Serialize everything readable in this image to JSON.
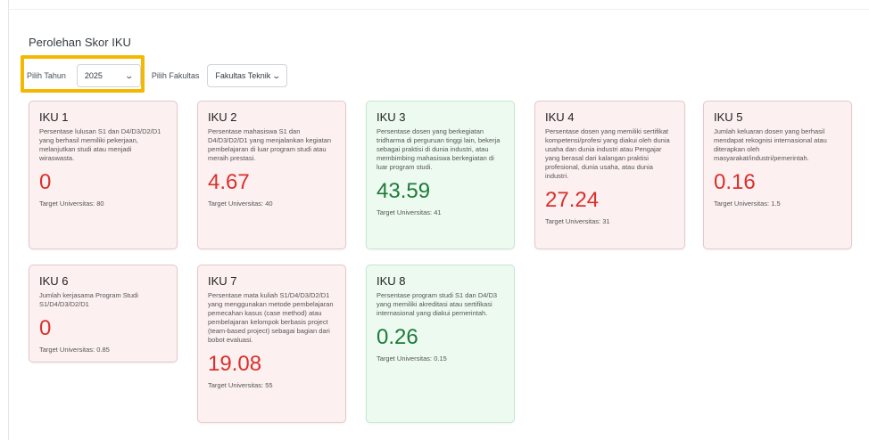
{
  "page_title": "Perolehan Skor IKU",
  "filters": {
    "year_label": "Pilih Tahun",
    "year_value": "2025",
    "faculty_label": "Pilih Fakultas",
    "faculty_value": "Fakultas Teknik"
  },
  "colors": {
    "highlight": "#f5b800",
    "below_target_bg": "#fdf0f0",
    "below_target_value": "#d9302c",
    "above_target_bg": "#ecfaf0",
    "above_target_value": "#1f7a3a"
  },
  "cards": [
    {
      "title": "IKU 1",
      "description": "Persentase lulusan S1 dan D4/D3/D2/D1 yang berhasil memiliki pekerjaan, melanjutkan studi atau menjadi wiraswasta.",
      "value": "0",
      "target": "Target Universitas: 80",
      "status": "bad"
    },
    {
      "title": "IKU 2",
      "description": "Persentase mahasiswa S1 dan D4/D3/D2/D1 yang menjalankan kegiatan pembelajaran di luar program studi atau meraih prestasi.",
      "value": "4.67",
      "target": "Target Universitas: 40",
      "status": "bad"
    },
    {
      "title": "IKU 3",
      "description": "Persentase dosen yang berkegiatan tridharma di perguruan tinggi lain, bekerja sebagai praktisi di dunia industri, atau membimbing mahasiswa berkegiatan di luar program studi.",
      "value": "43.59",
      "target": "Target Universitas: 41",
      "status": "good"
    },
    {
      "title": "IKU 4",
      "description": "Persentase dosen yang memiliki sertifikat kompetensi/profesi yang diakui oleh dunia usaha dan dunia industri atau Pengajar yang berasal dari kalangan praktisi profesional, dunia usaha, atau dunia industri.",
      "value": "27.24",
      "target": "Target Universitas: 31",
      "status": "bad"
    },
    {
      "title": "IKU 5",
      "description": "Jumlah keluaran dosen yang berhasil mendapat rekognisi internasional atau diterapkan oleh masyarakat/industri/pemerintah.",
      "value": "0.16",
      "target": "Target Universitas: 1.5",
      "status": "bad"
    },
    {
      "title": "IKU 6",
      "description": "Jumlah kerjasama Program Studi S1/D4/D3/D2/D1",
      "value": "0",
      "target": "Target Universitas: 0.85",
      "status": "bad"
    },
    {
      "title": "IKU 7",
      "description": "Persentase mata kuliah S1/D4/D3/D2/D1 yang menggunakan metode pembelajaran pemecahan kasus (case method) atau pembelajaran kelompok berbasis project (team-based project) sebagai bagian dari bobot evaluasi.",
      "value": "19.08",
      "target": "Target Universitas: 55",
      "status": "bad"
    },
    {
      "title": "IKU 8",
      "description": "Persentase program studi S1 dan D4/D3 yang memiliki akreditasi atau sertifikasi internasional yang diakui pemerintah.",
      "value": "0.26",
      "target": "Target Universitas: 0.15",
      "status": "good"
    }
  ]
}
